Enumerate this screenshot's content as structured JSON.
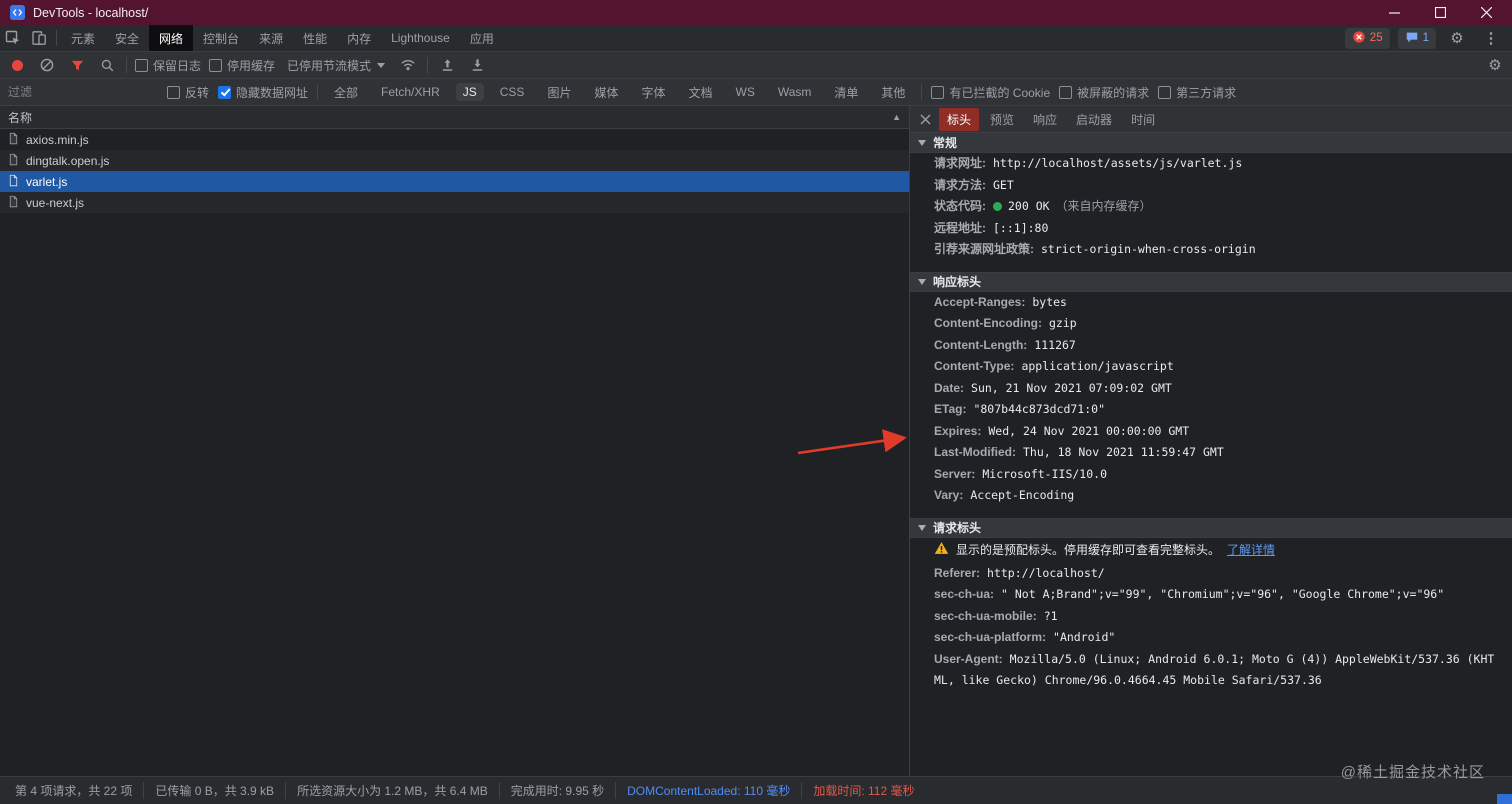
{
  "titlebar": {
    "title": "DevTools - localhost/"
  },
  "icons": {
    "gear": "⚙",
    "kebab": "⋮",
    "sort_asc": "▲"
  },
  "main_tabs": {
    "items": [
      {
        "label": "元素"
      },
      {
        "label": "安全"
      },
      {
        "label": "网络"
      },
      {
        "label": "控制台"
      },
      {
        "label": "来源"
      },
      {
        "label": "性能"
      },
      {
        "label": "内存"
      },
      {
        "label": "Lighthouse"
      },
      {
        "label": "应用"
      }
    ],
    "selected": "网络",
    "error_count": "25",
    "message_count": "1"
  },
  "network_toolbar": {
    "preserve_log_label": "保留日志",
    "disable_cache_label": "停用缓存",
    "throttling_value": "已停用节流模式"
  },
  "filter_bar": {
    "placeholder": "过滤",
    "invert_label": "反转",
    "hide_data_urls_label": "隐藏数据网址",
    "hide_data_urls_checked": true,
    "type_chips": [
      "全部",
      "Fetch/XHR",
      "JS",
      "CSS",
      "图片",
      "媒体",
      "字体",
      "文档",
      "WS",
      "Wasm",
      "清单",
      "其他"
    ],
    "selected_chip": "JS",
    "blocked_cookies_label": "有已拦截的 Cookie",
    "blocked_requests_label": "被屏蔽的请求",
    "third_party_label": "第三方请求"
  },
  "request_table": {
    "name_header": "名称",
    "rows": [
      {
        "name": "axios.min.js",
        "selected": false
      },
      {
        "name": "dingtalk.open.js",
        "selected": false
      },
      {
        "name": "varlet.js",
        "selected": true
      },
      {
        "name": "vue-next.js",
        "selected": false
      }
    ]
  },
  "details": {
    "tabs": [
      {
        "label": "标头"
      },
      {
        "label": "预览"
      },
      {
        "label": "响应"
      },
      {
        "label": "启动器"
      },
      {
        "label": "时间"
      }
    ],
    "selected_tab": "标头",
    "general": {
      "title": "常规",
      "rows": [
        {
          "key": "请求网址:",
          "value": "http://localhost/assets/js/varlet.js"
        },
        {
          "key": "请求方法:",
          "value": "GET"
        },
        {
          "key": "状态代码:",
          "value": "200 OK",
          "note": "（来自内存缓存）"
        },
        {
          "key": "远程地址:",
          "value": "[::1]:80"
        },
        {
          "key": "引荐来源网址政策:",
          "value": "strict-origin-when-cross-origin"
        }
      ]
    },
    "response_headers": {
      "title": "响应标头",
      "rows": [
        {
          "key": "Accept-Ranges:",
          "value": "bytes"
        },
        {
          "key": "Content-Encoding:",
          "value": "gzip"
        },
        {
          "key": "Content-Length:",
          "value": "111267"
        },
        {
          "key": "Content-Type:",
          "value": "application/javascript"
        },
        {
          "key": "Date:",
          "value": "Sun, 21 Nov 2021 07:09:02 GMT"
        },
        {
          "key": "ETag:",
          "value": "\"807b44c873dcd71:0\""
        },
        {
          "key": "Expires:",
          "value": "Wed, 24 Nov 2021 00:00:00 GMT"
        },
        {
          "key": "Last-Modified:",
          "value": "Thu, 18 Nov 2021 11:59:47 GMT"
        },
        {
          "key": "Server:",
          "value": "Microsoft-IIS/10.0"
        },
        {
          "key": "Vary:",
          "value": "Accept-Encoding"
        }
      ]
    },
    "request_headers": {
      "title": "请求标头",
      "warning_text": "显示的是预配标头。停用缓存即可查看完整标头。",
      "warning_link": "了解详情",
      "rows": [
        {
          "key": "Referer:",
          "value": "http://localhost/"
        },
        {
          "key": "sec-ch-ua:",
          "value": "\" Not A;Brand\";v=\"99\", \"Chromium\";v=\"96\", \"Google Chrome\";v=\"96\""
        },
        {
          "key": "sec-ch-ua-mobile:",
          "value": "?1"
        },
        {
          "key": "sec-ch-ua-platform:",
          "value": "\"Android\""
        },
        {
          "key": "User-Agent:",
          "value": "Mozilla/5.0 (Linux; Android 6.0.1; Moto G (4)) AppleWebKit/537.36 (KHTML, like Gecko) Chrome/96.0.4664.45 Mobile Safari/537.36"
        }
      ]
    }
  },
  "status_bar": {
    "items": [
      {
        "text": "第 4 项请求，共 22 项"
      },
      {
        "text": "已传输 0 B，共 3.9 kB"
      },
      {
        "text": "所选资源大小为 1.2 MB，共 6.4 MB"
      },
      {
        "text": "完成用时: 9.95 秒"
      },
      {
        "text": "DOMContentLoaded: 110 毫秒",
        "color": "#4f8df6"
      },
      {
        "text": "加载时间: 112 毫秒",
        "color": "#e5564b"
      }
    ]
  },
  "watermark": "@稀土掘金技术社区",
  "colors": {
    "titlebar": "#54132f",
    "accent_blue": "#1a73e8",
    "selected_row_blue": "#2158a4",
    "selected_headers_tab_red": "#8e2e27",
    "status_green": "#2faa53",
    "record_red": "#e8463c",
    "warning_yellow": "#f2b01e",
    "annotation_arrow_red": "#e33b2a"
  }
}
